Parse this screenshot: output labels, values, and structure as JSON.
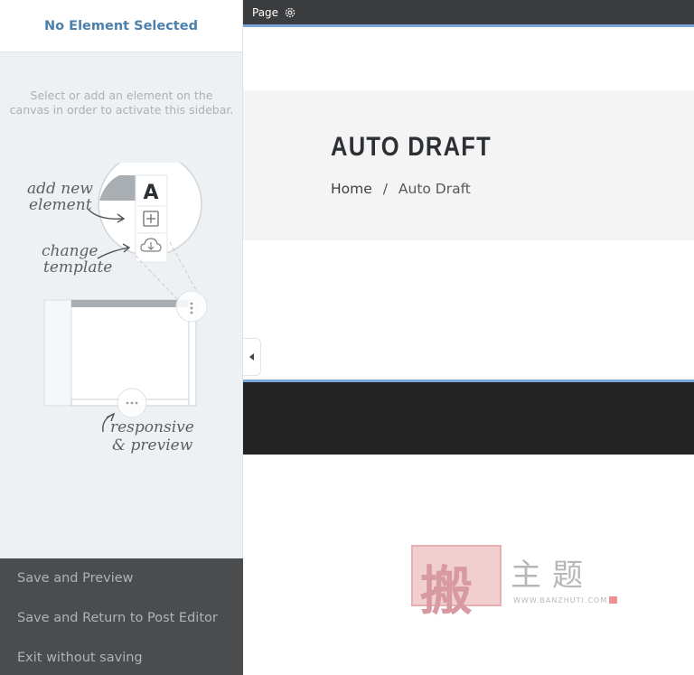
{
  "sidebar": {
    "title": "No Element Selected",
    "hint": "Select or add an element on the canvas in order to activate this sidebar.",
    "illustration": {
      "add_label_1": "add new",
      "add_label_2": "element",
      "change_label_1": "change",
      "change_label_2": "template",
      "responsive_label_1": "responsive",
      "responsive_label_2": "& preview",
      "logo_letter": "A"
    },
    "footer": {
      "save_preview": "Save and Preview",
      "save_return": "Save and Return to Post Editor",
      "exit": "Exit without saving"
    }
  },
  "topbar": {
    "label": "Page"
  },
  "canvas": {
    "title": "AUTO DRAFT",
    "breadcrumb": {
      "home": "Home",
      "separator": "/",
      "current": "Auto Draft"
    }
  },
  "watermark": {
    "seal_char": "搬",
    "text": "主题",
    "url": "WWW.BANZHUTI.COM"
  },
  "colors": {
    "accent": "#7aa5d8",
    "title_blue": "#4a7fae",
    "sidebar_bg": "#eef1f3",
    "footer_bg": "#4b4c4e",
    "topbar_bg": "#3b3c3e"
  }
}
